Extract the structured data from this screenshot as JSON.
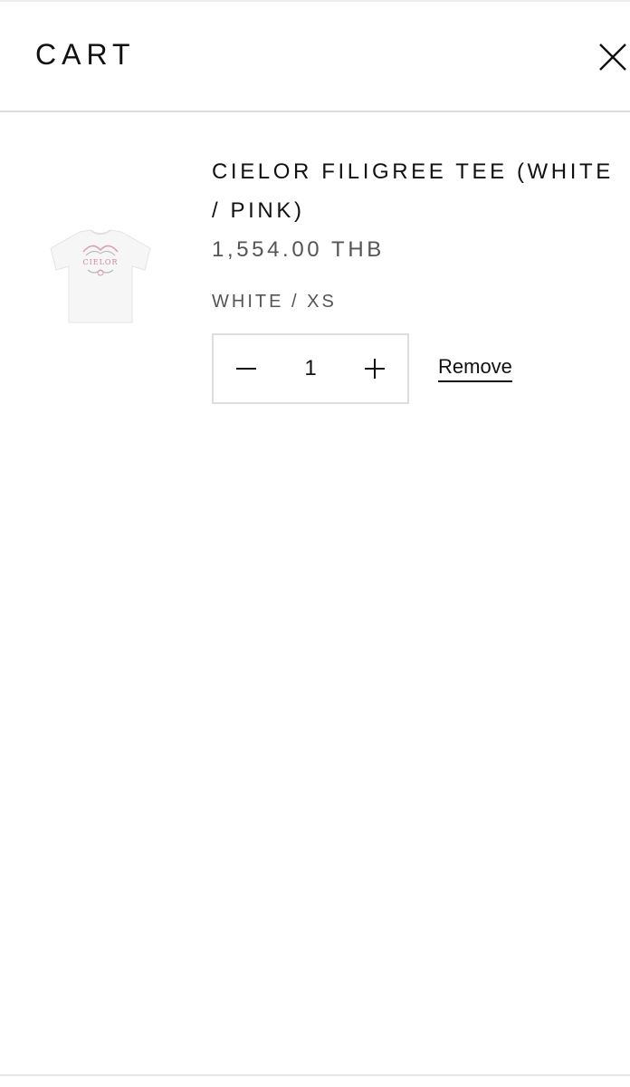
{
  "header": {
    "title": "CART",
    "close_icon": "close-icon"
  },
  "cart": {
    "items": [
      {
        "name": "CIELOR FILIGREE TEE (WHITE / PINK)",
        "price": "1,554.00 THB",
        "variant": "WHITE / XS",
        "quantity": "1",
        "image_brand_text": "CIELOR",
        "remove_label": "Remove",
        "minus_icon": "minus-icon",
        "plus_icon": "plus-icon"
      }
    ]
  },
  "colors": {
    "text": "#111111",
    "muted": "#555555",
    "border": "#dddddd",
    "background": "#ffffff",
    "print_pink": "#d9a0b3"
  }
}
